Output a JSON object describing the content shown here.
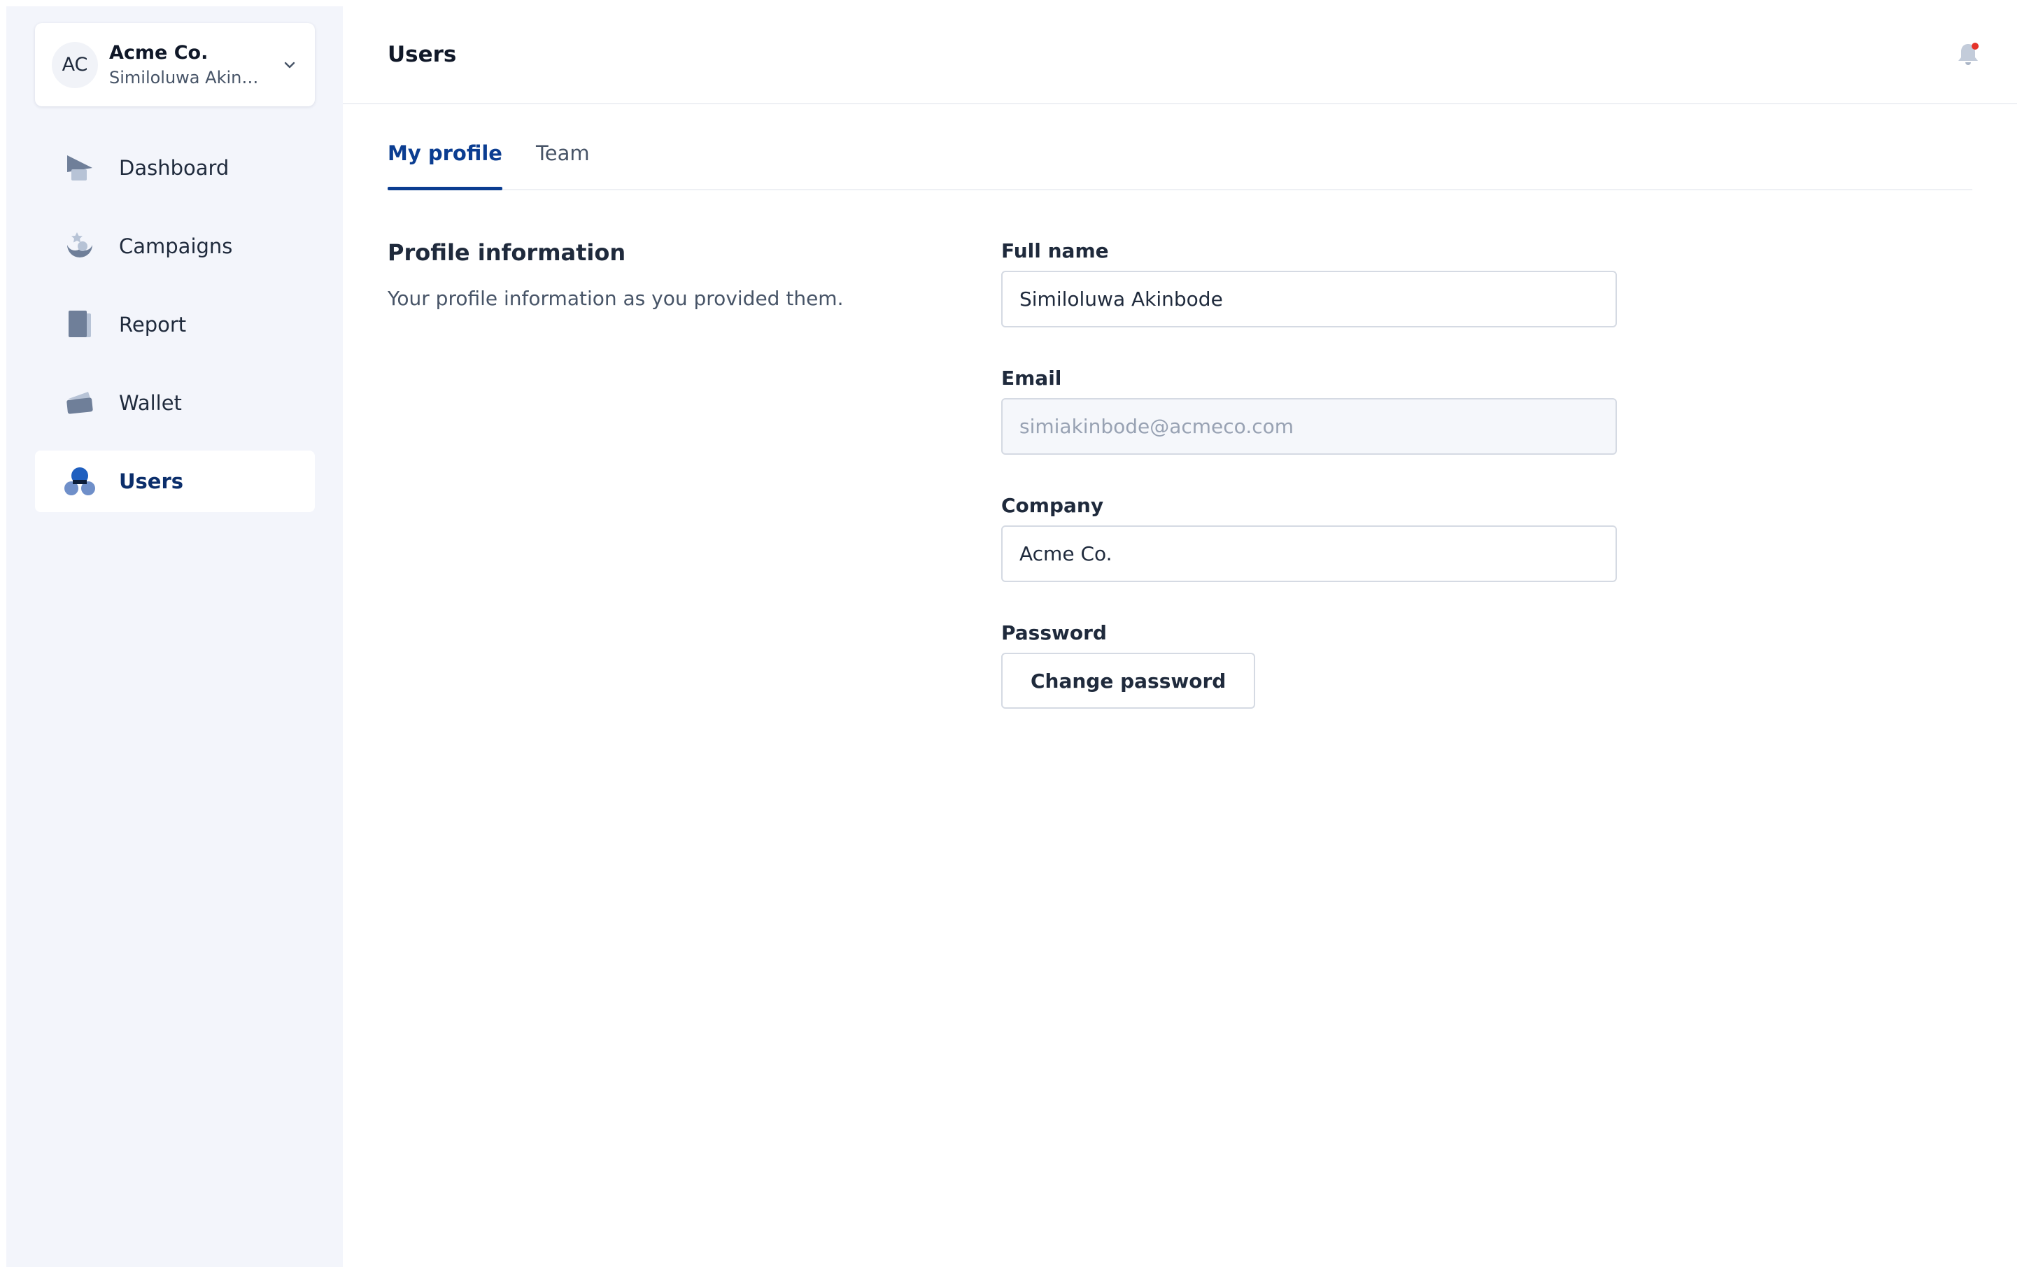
{
  "org": {
    "initials": "AC",
    "name": "Acme Co.",
    "user": "Similoluwa Akinb..."
  },
  "sidebar": {
    "items": [
      {
        "label": "Dashboard",
        "icon": "dashboard-icon"
      },
      {
        "label": "Campaigns",
        "icon": "campaigns-icon"
      },
      {
        "label": "Report",
        "icon": "report-icon"
      },
      {
        "label": "Wallet",
        "icon": "wallet-icon"
      },
      {
        "label": "Users",
        "icon": "users-icon",
        "active": true
      }
    ]
  },
  "header": {
    "title": "Users",
    "notification_icon": "bell-icon"
  },
  "tabs": [
    {
      "label": "My profile",
      "active": true
    },
    {
      "label": "Team"
    }
  ],
  "profile": {
    "title": "Profile information",
    "subtitle": "Your profile information as you provided them.",
    "full_name": {
      "label": "Full name",
      "value": "Similoluwa Akinbode"
    },
    "email": {
      "label": "Email",
      "value": "simiakinbode@acmeco.com"
    },
    "company": {
      "label": "Company",
      "value": "Acme Co."
    },
    "password": {
      "label": "Password",
      "button": "Change password"
    }
  },
  "colors": {
    "accent": "#0b3d91",
    "sidebar_bg": "#f3f5fb",
    "icon_muted": "#7d8ba3",
    "notification_dot": "#e5332a"
  }
}
